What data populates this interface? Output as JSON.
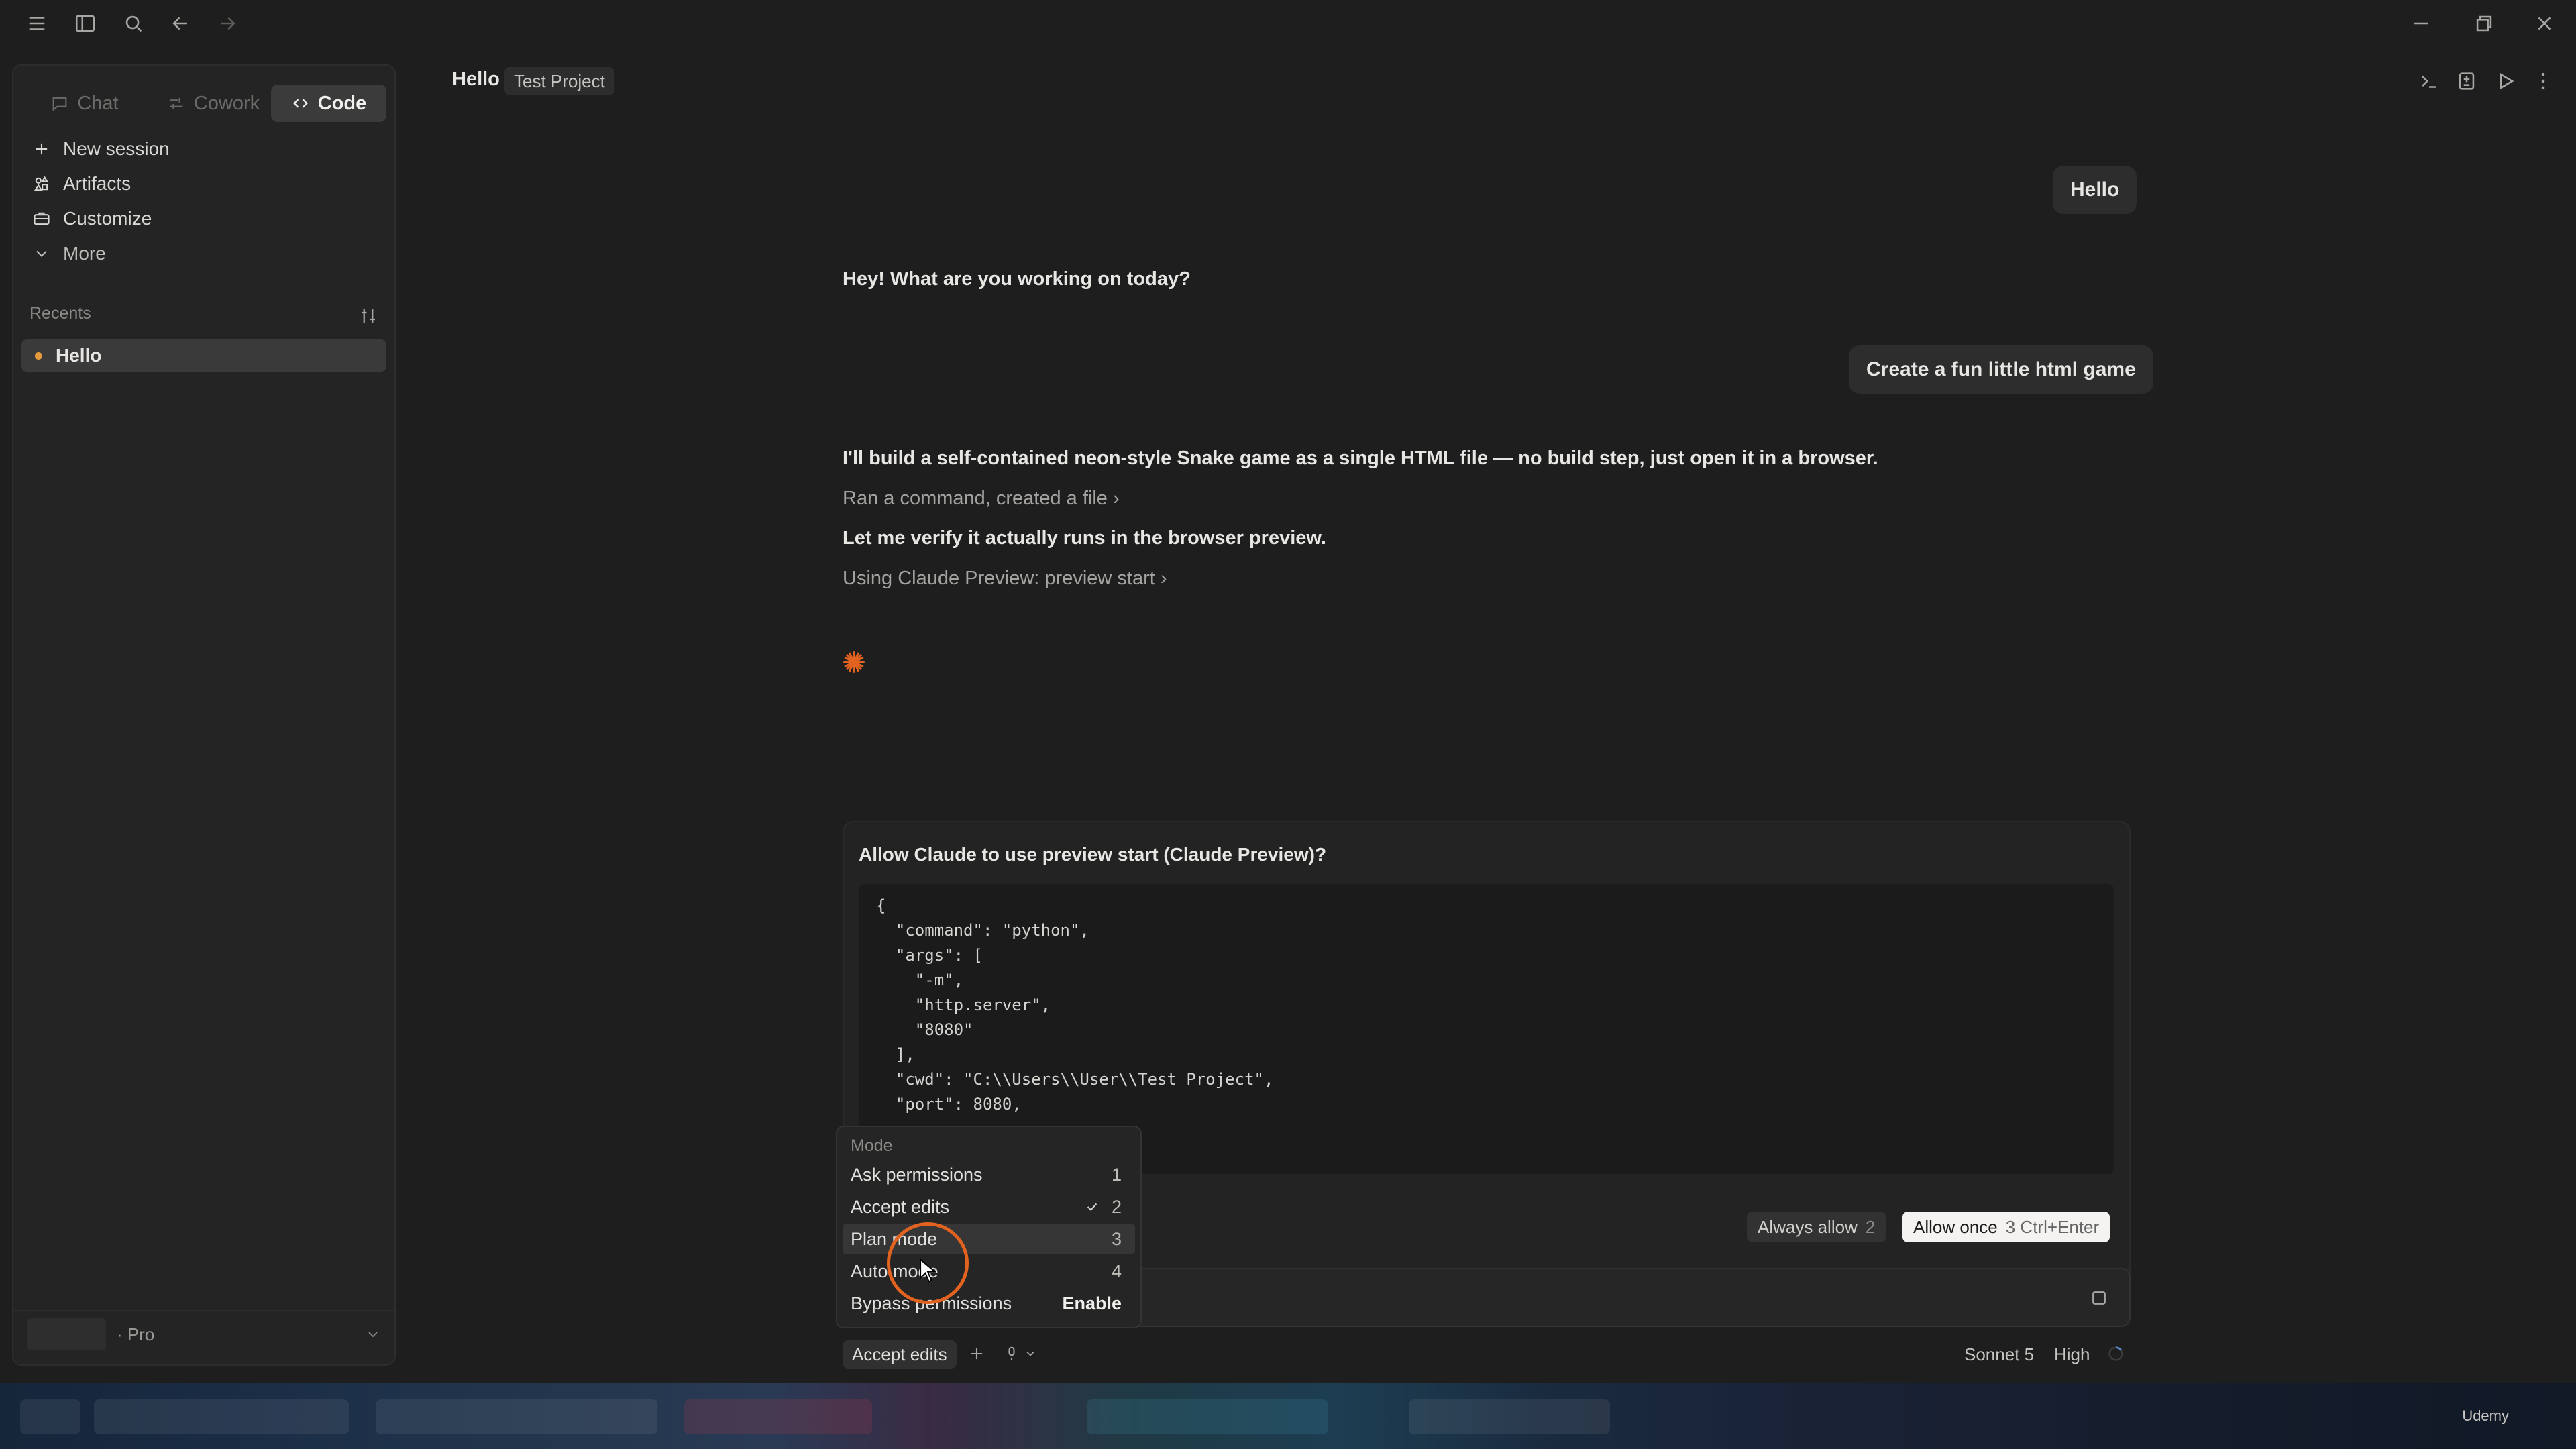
{
  "sidebar": {
    "modes": [
      {
        "label": "Chat"
      },
      {
        "label": "Cowork"
      },
      {
        "label": "Code"
      }
    ],
    "nav": [
      {
        "label": "New session"
      },
      {
        "label": "Artifacts"
      },
      {
        "label": "Customize"
      },
      {
        "label": "More"
      }
    ],
    "recents_label": "Recents",
    "recents": [
      {
        "label": "Hello"
      }
    ],
    "plan_label": "· Pro"
  },
  "header": {
    "title": "Hello",
    "project": "Test Project"
  },
  "chat": {
    "user_msg_1": "Hello",
    "assistant_msg_1": "Hey! What are you working on today?",
    "user_msg_2": "Create a fun little html game",
    "assistant_msg_2": "I'll build a self-contained neon-style Snake game as a single HTML file — no build step, just open it in a browser.",
    "tool_summary_1": "Ran a command, created a file",
    "assistant_msg_3": "Let me verify it actually runs in the browser preview.",
    "tool_summary_2": "Using Claude Preview: preview start"
  },
  "permission": {
    "title": "Allow Claude to use preview start (Claude Preview)?",
    "code_lines": [
      "{",
      "  \"command\": \"python\",",
      "  \"args\": [",
      "    \"-m\",",
      "    \"http.server\",",
      "    \"8080\"",
      "  ],",
      "  \"cwd\": \"C:\\\\Users\\\\User\\\\Test Project\",",
      "  \"port\": 8080,"
    ],
    "always_allow": {
      "label": "Always allow",
      "key": "2"
    },
    "allow_once": {
      "label": "Allow once",
      "key": "3 Ctrl+Enter"
    }
  },
  "mode_menu": {
    "header": "Mode",
    "items": [
      {
        "label": "Ask permissions",
        "key": "1",
        "checked": false
      },
      {
        "label": "Accept edits",
        "key": "2",
        "checked": true
      },
      {
        "label": "Plan mode",
        "key": "3",
        "checked": false
      },
      {
        "label": "Auto mode",
        "key": "4",
        "checked": false
      },
      {
        "label": "Bypass permissions",
        "key": "Enable",
        "checked": false
      }
    ]
  },
  "toolbar": {
    "mode": "Accept edits",
    "model": "Sonnet 5",
    "effort": "High"
  },
  "taskbar": {
    "watermark": "Udemy"
  },
  "colors": {
    "background": "#1e1e1e",
    "sidebar": "#242424",
    "accent_orange": "#e2631f",
    "recent_dot": "#e39a3c"
  }
}
